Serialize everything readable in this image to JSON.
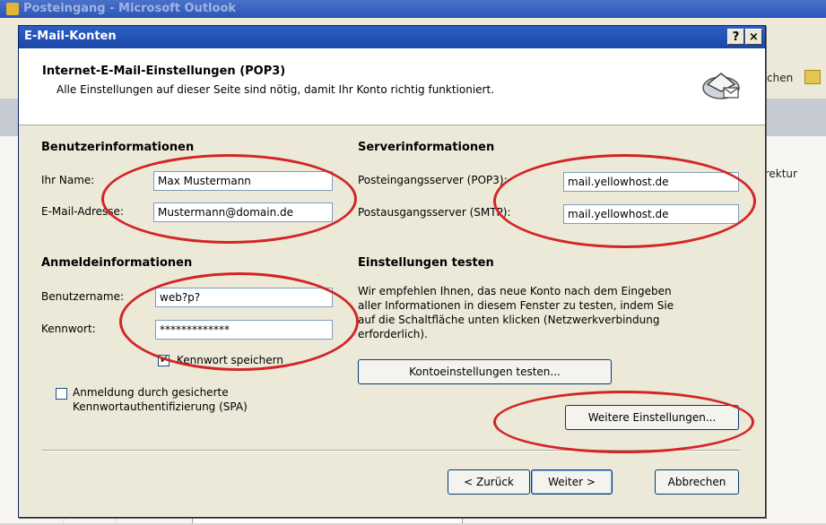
{
  "background_window": {
    "title": "Posteingang - Microsoft Outlook",
    "toolbar_text": "chen",
    "column_text": "rrektur"
  },
  "dialog": {
    "title": "E-Mail-Konten",
    "help_label": "?",
    "close_label": "×",
    "header_title": "Internet-E-Mail-Einstellungen (POP3)",
    "header_subtitle": "Alle Einstellungen auf dieser Seite sind nötig, damit Ihr Konto richtig funktioniert.",
    "user_info": {
      "heading": "Benutzerinformationen",
      "name_label": "Ihr Name:",
      "name_value": "Max Mustermann",
      "email_label": "E-Mail-Adresse:",
      "email_value": "Mustermann@domain.de"
    },
    "server_info": {
      "heading": "Serverinformationen",
      "incoming_label": "Posteingangsserver (POP3):",
      "incoming_value": "mail.yellowhost.de",
      "outgoing_label": "Postausgangsserver (SMTP):",
      "outgoing_value": "mail.yellowhost.de"
    },
    "login_info": {
      "heading": "Anmeldeinformationen",
      "username_label": "Benutzername:",
      "username_value": "web?p?",
      "password_label": "Kennwort:",
      "password_value": "*************",
      "remember_label": "Kennwort speichern",
      "remember_checked": true,
      "spa_label_line1": "Anmeldung durch gesicherte",
      "spa_label_line2": "Kennwortauthentifizierung (SPA)",
      "spa_checked": false
    },
    "test_settings": {
      "heading": "Einstellungen testen",
      "description_lines": [
        "Wir empfehlen Ihnen, das neue Konto nach dem Eingeben",
        "aller Informationen in diesem Fenster zu testen, indem Sie",
        "auf die Schaltfläche unten klicken (Netzwerkverbindung",
        "erforderlich)."
      ],
      "test_button": "Kontoeinstellungen testen..."
    },
    "more_settings_button": "Weitere Einstellungen...",
    "back_button": "< Zurück",
    "next_button": "Weiter >",
    "cancel_button": "Abbrechen"
  },
  "colors": {
    "annotation": "#d22525",
    "titlebar": "#2d5fc4",
    "dialog_bg": "#ece9d8"
  }
}
